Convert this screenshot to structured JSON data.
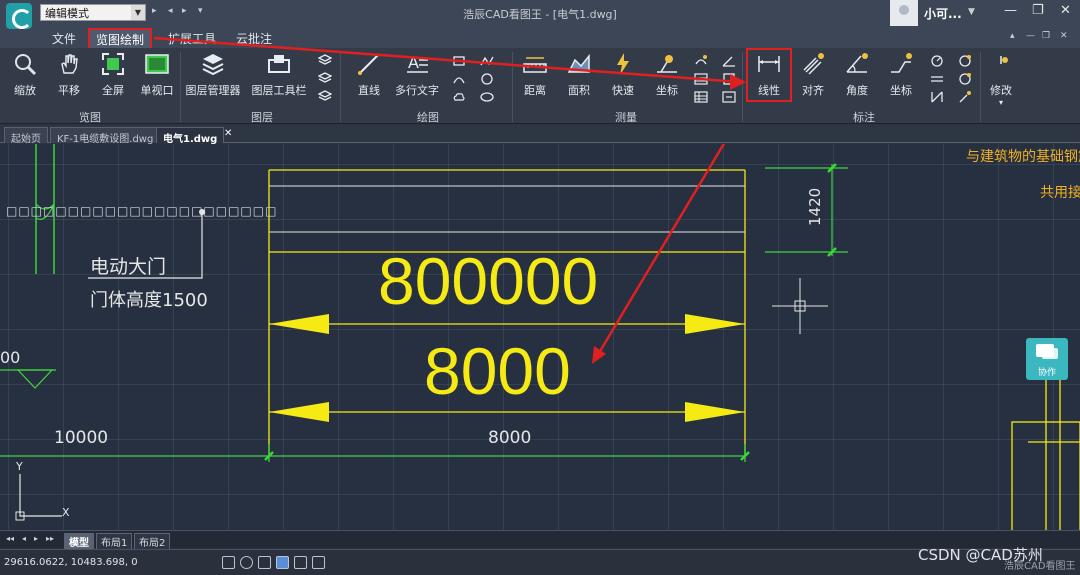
{
  "titlebar": {
    "mode_select_value": "编辑模式",
    "window_title": "浩辰CAD看图王 - [电气1.dwg]",
    "user_name": "小可...",
    "quick_access": [
      "▸",
      "◂",
      "▸",
      "▾"
    ],
    "window_buttons": {
      "minimize": "—",
      "restore": "❐",
      "close": "✕"
    }
  },
  "menu": {
    "items": [
      {
        "label": "文件"
      },
      {
        "label": "览图绘制",
        "active": true
      },
      {
        "label": "扩展工具"
      },
      {
        "label": "云批注"
      }
    ],
    "mdi_buttons": [
      "▴",
      "—",
      "❐",
      "✕"
    ]
  },
  "ribbon": {
    "groups": [
      {
        "label": "览图"
      },
      {
        "label": "图层"
      },
      {
        "label": "绘图"
      },
      {
        "label": "测量"
      },
      {
        "label": "标注"
      }
    ],
    "buttons": {
      "zoom": "缩放",
      "pan": "平移",
      "fullscreen": "全屏",
      "single_viewport": "单视口",
      "layer_manager": "图层管理器",
      "layer_toolbar": "图层工具栏",
      "line": "直线",
      "mtext": "多行文字",
      "distance": "距离",
      "area": "面积",
      "quick": "快速",
      "coordinate": "坐标",
      "linear": "线性",
      "aligned": "对齐",
      "angle": "角度",
      "coord_dim": "坐标",
      "modify": "修改"
    }
  },
  "tabs": {
    "docs": [
      {
        "label": "起始页"
      },
      {
        "label": "KF-1电缆敷设图.dwg"
      },
      {
        "label": "电气1.dwg",
        "active": true
      }
    ],
    "close_glyph": "✕"
  },
  "drawing": {
    "note_line1": "电动大门",
    "note_line2": "门体高度1500",
    "top_right_line1": "与建筑物的基础钢筋",
    "top_right_line2": "共用接",
    "dim_large": "800000",
    "dim_medium": "8000",
    "dim_bottom_right": "8000",
    "dim_bottom_left": "10000",
    "dim_vertical": "1420",
    "left_partial": "00",
    "ucs_y": "Y",
    "ucs_x": "X",
    "box_text": "□□□□□□□□□□□□□□□□□□□□□□"
  },
  "side_panel": {
    "collab_label": "协作"
  },
  "layouts": {
    "nav": [
      "◂◂",
      "◂",
      "▸",
      "▸▸"
    ],
    "tabs": [
      {
        "label": "模型",
        "active": true
      },
      {
        "label": "布局1"
      },
      {
        "label": "布局2"
      }
    ]
  },
  "status": {
    "coordinates": "29616.0622, 10483.698, 0",
    "right_text": "浩辰CAD看图王"
  },
  "watermark": "CSDN @CAD苏州",
  "colors": {
    "accent_red": "#e02020",
    "cad_yellow": "#f5ea14",
    "cad_white": "#e6e6e6",
    "cad_green": "#3cd63c",
    "collab_cyan": "#3bb7c0"
  }
}
